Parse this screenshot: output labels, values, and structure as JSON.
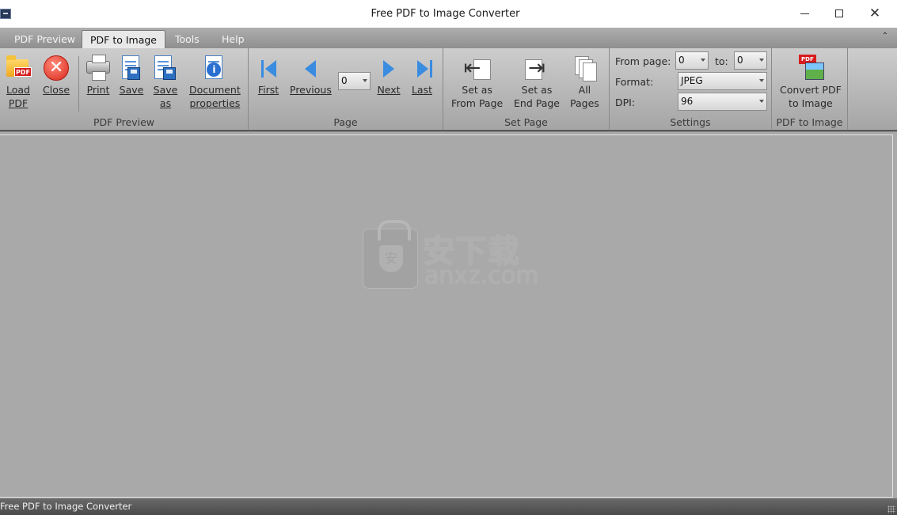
{
  "window": {
    "title": "Free PDF to Image Converter",
    "minimize_icon": "minimize-icon",
    "maximize_icon": "maximize-icon",
    "close_icon": "close-icon"
  },
  "tabs": [
    {
      "label": "PDF Preview",
      "active": false
    },
    {
      "label": "PDF to Image",
      "active": true
    },
    {
      "label": "Tools",
      "active": false
    },
    {
      "label": "Help",
      "active": false
    }
  ],
  "ribbon": {
    "pdf_preview": {
      "group_label": "PDF Preview",
      "load_pdf": "Load\nPDF",
      "close": "Close",
      "print": "Print",
      "save": "Save",
      "save_as": "Save\nas",
      "document_properties": "Document\nproperties"
    },
    "page": {
      "group_label": "Page",
      "first": "First",
      "previous": "Previous",
      "current_page": "0",
      "next": "Next",
      "last": "Last"
    },
    "set_page": {
      "group_label": "Set Page",
      "set_from": "Set as\nFrom Page",
      "set_end": "Set as\nEnd Page",
      "all_pages": "All\nPages"
    },
    "settings": {
      "group_label": "Settings",
      "from_page_label": "From page:",
      "from_page_value": "0",
      "to_label": "to:",
      "to_value": "0",
      "format_label": "Format:",
      "format_value": "JPEG",
      "dpi_label": "DPI:",
      "dpi_value": "96"
    },
    "convert": {
      "group_label": "PDF to Image",
      "button": "Convert PDF\nto Image"
    }
  },
  "watermark": {
    "cn": "安下载",
    "en": "anxz.com"
  },
  "status": {
    "text": "Free PDF to Image Converter"
  }
}
